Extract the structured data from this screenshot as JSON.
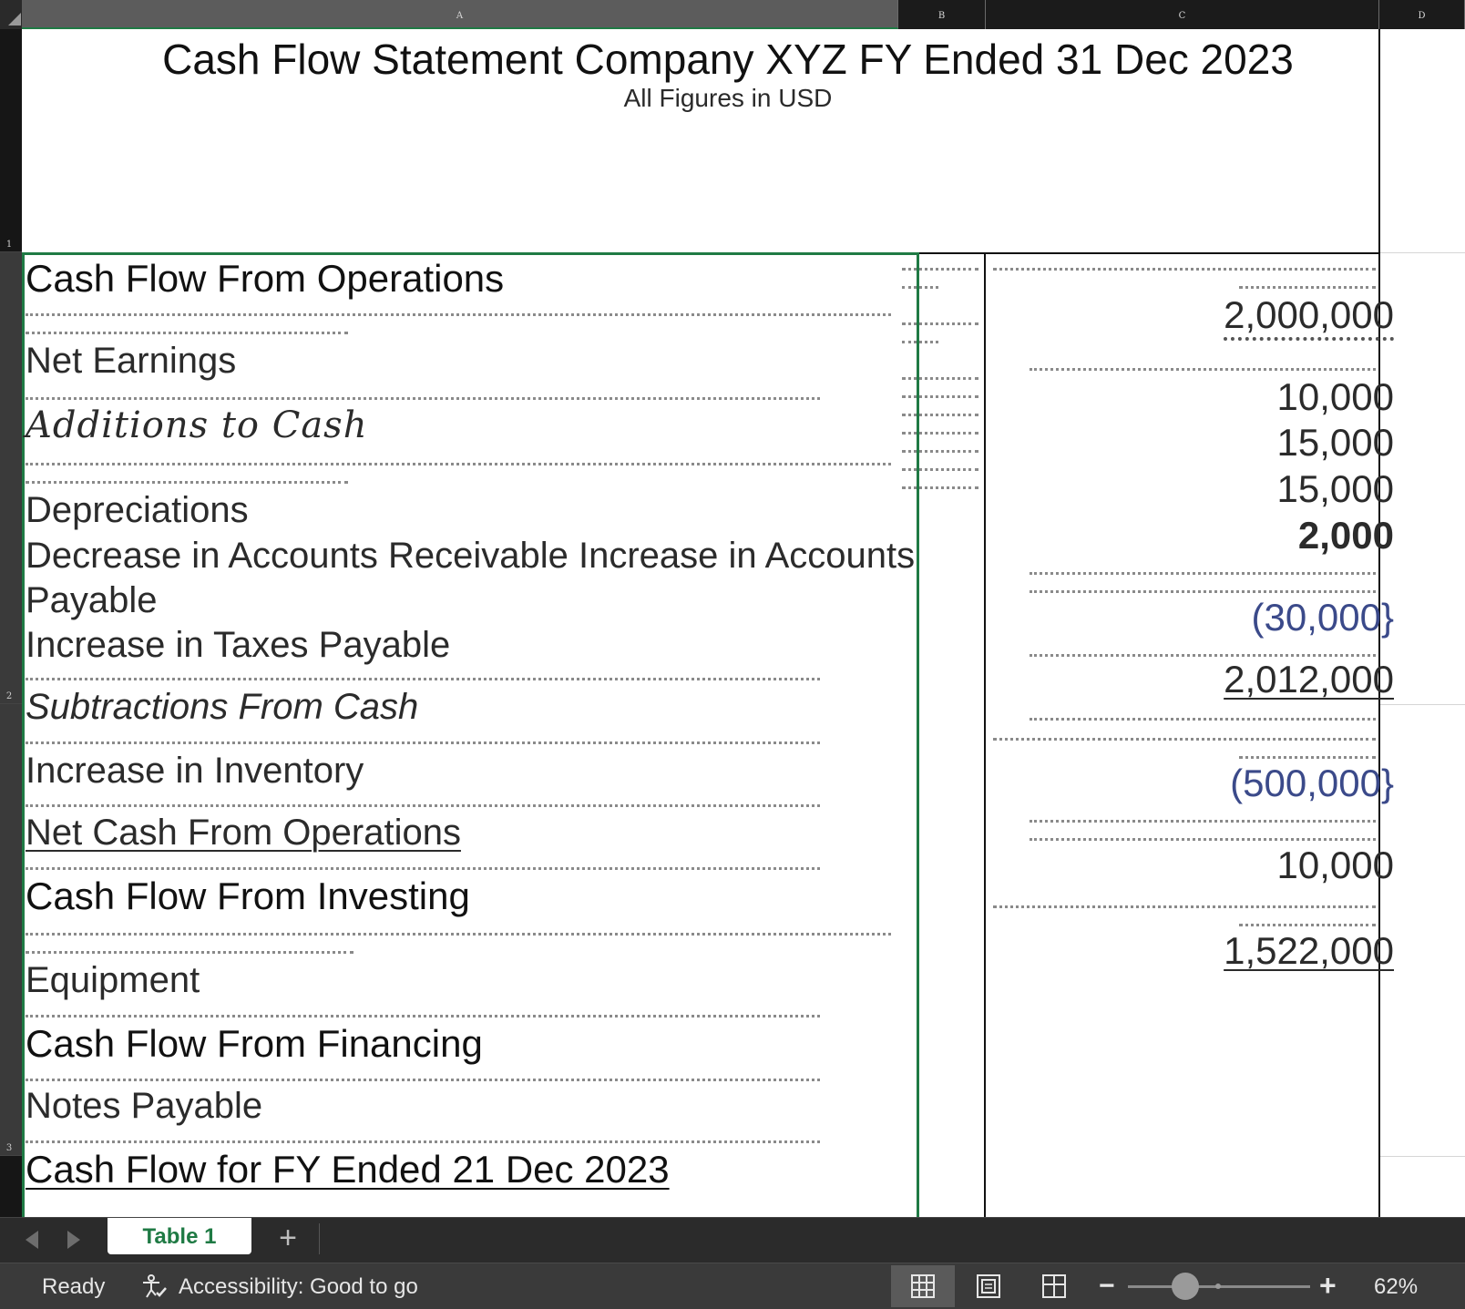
{
  "columns": [
    "A",
    "B",
    "C",
    "D"
  ],
  "rows": [
    "1",
    "2",
    "3"
  ],
  "sheet": {
    "title": "Cash Flow Statement Company XYZ FY Ended 31 Dec 2023",
    "subtitle": "All Figures in USD"
  },
  "labels": {
    "cf_operations": "Cash Flow From Operations",
    "net_earnings": "Net   Earnings",
    "additions": "Additions to Cash",
    "depreciations": "Depreciations",
    "decrease_ar_line1": "Decrease in Accounts Receivable Increase in Accounts",
    "decrease_ar_line2": "Payable",
    "taxes": "Increase in Taxes Payable",
    "subtractions": "Subtractions From Cash",
    "inventory": "Increase in Inventory",
    "net_cash_ops": "Net  Cash From Operations",
    "cf_investing": "Cash Flow From Investing",
    "equipment": "Equipment",
    "cf_financing": "Cash Flow From Financing",
    "notes_payable": "Notes Payable",
    "cf_fy": "Cash Flow for FY Ended 21 Dec 2023"
  },
  "values": {
    "v1": "2,000,000",
    "v2": "10,000",
    "v3": "15,000",
    "v4": "15,000",
    "v5": "2,000",
    "v6": "(30,000}",
    "v7": "2,012,000",
    "v8": "(500,000}",
    "v9": "10,000",
    "v10": "1,522,000"
  },
  "tabs": {
    "active": "Table 1",
    "add": "+"
  },
  "status": {
    "ready": "Ready",
    "accessibility": "Accessibility: Good to go",
    "zoom_minus": "−",
    "zoom_plus": "+",
    "zoom": "62%",
    "zoom_level": 0.62
  },
  "colors": {
    "accent": "#1f7a44",
    "negative": "#3b4a8a"
  }
}
